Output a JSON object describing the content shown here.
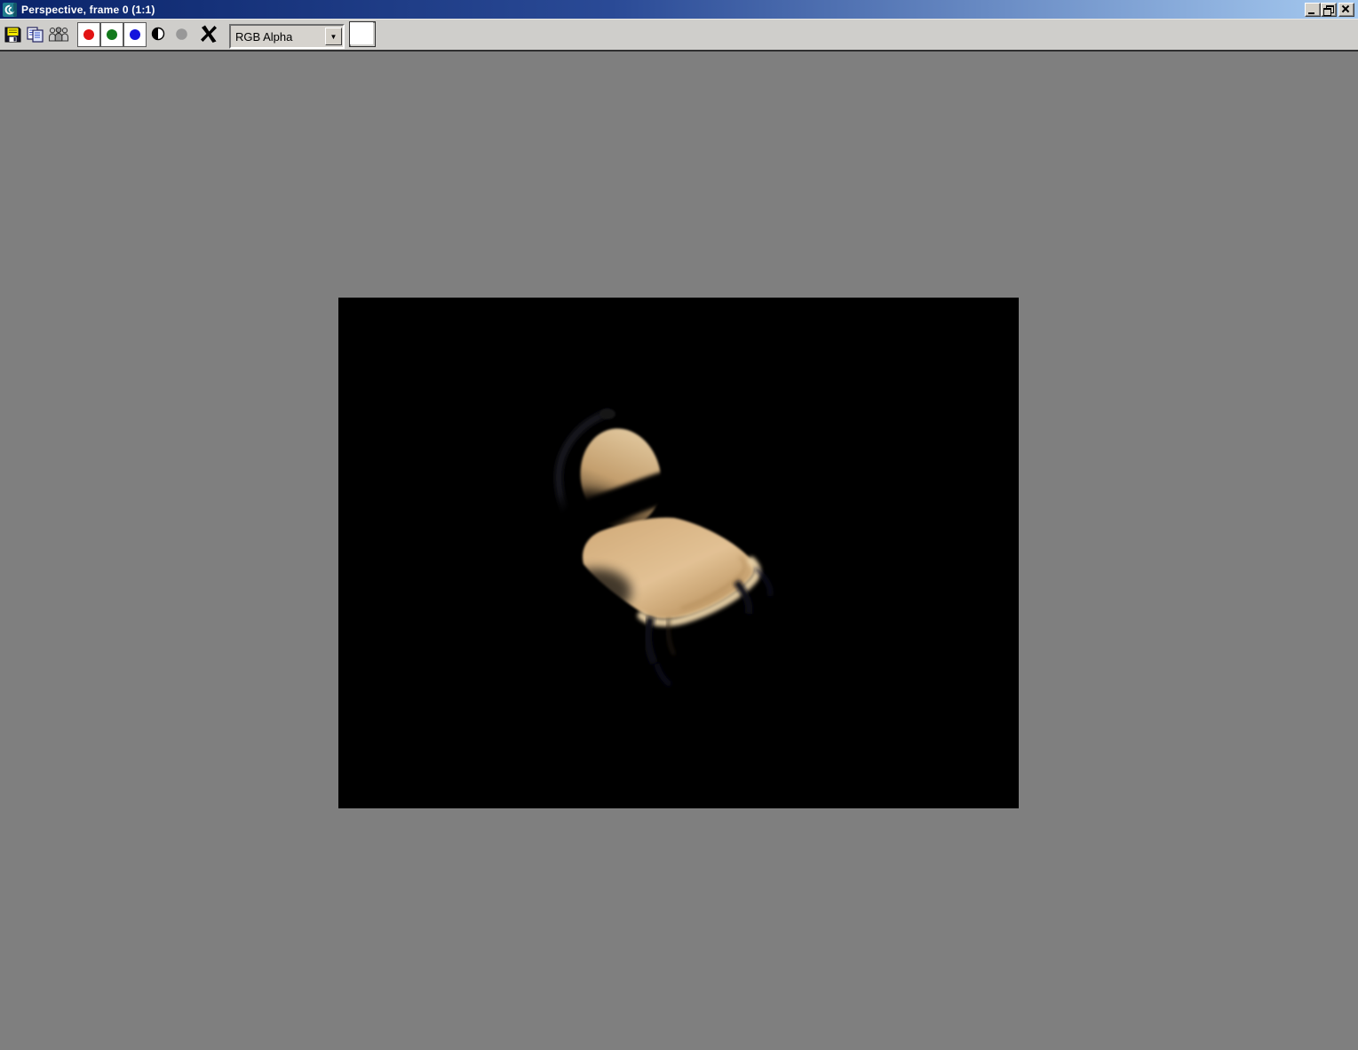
{
  "window": {
    "title": "Perspective, frame 0 (1:1)"
  },
  "icons": {
    "app": "3ds-max-swirl",
    "save": "floppy-disk",
    "copy": "copy-pages",
    "clone": "clone-group",
    "alpha": "half-black-white-circle",
    "monochrome": "gray-dot",
    "clear": "black-x",
    "dropdown_arrow": "▼"
  },
  "toolbar": {
    "channels": [
      {
        "id": "red",
        "color": "#e21313",
        "pressed": true
      },
      {
        "id": "green",
        "color": "#12791c",
        "pressed": true
      },
      {
        "id": "blue",
        "color": "#1414dd",
        "pressed": true
      }
    ],
    "mono_color": "#989898",
    "dropdown_value": "RGB Alpha",
    "swatch_color": "#ffffff"
  },
  "viewport": {
    "background_color": "#7f7f7f",
    "render_background": "#000000",
    "render_subject": "chair",
    "chair_colors": {
      "backrest_light": "#e0c69c",
      "backrest_mid": "#c49f6e",
      "backrest_dark": "#241a0e",
      "seat_mid": "#d3ad7c",
      "seat_light": "#e2c194",
      "seat_dark": "#b8905c",
      "roll_highlight": "#ecd4a9"
    }
  }
}
